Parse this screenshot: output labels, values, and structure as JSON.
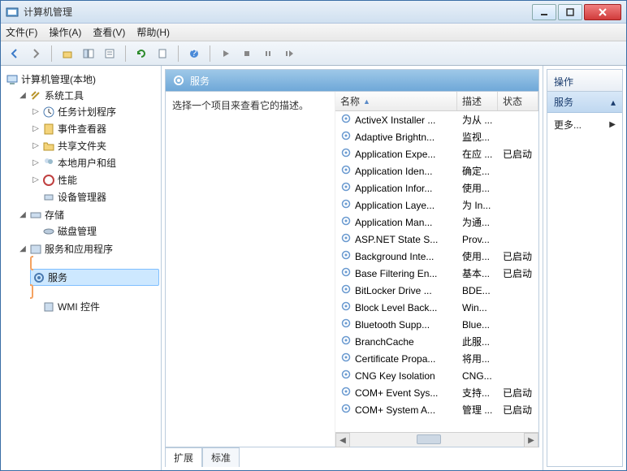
{
  "window": {
    "title": "计算机管理"
  },
  "menu": {
    "file": "文件(F)",
    "action": "操作(A)",
    "view": "查看(V)",
    "help": "帮助(H)"
  },
  "tree": {
    "root": "计算机管理(本地)",
    "systools": "系统工具",
    "task_scheduler": "任务计划程序",
    "event_viewer": "事件查看器",
    "shared_folders": "共享文件夹",
    "local_users": "本地用户和组",
    "performance": "性能",
    "device_manager": "设备管理器",
    "storage": "存储",
    "disk_mgmt": "磁盘管理",
    "services_apps": "服务和应用程序",
    "services": "服务",
    "wmi": "WMI 控件"
  },
  "mid": {
    "header": "服务",
    "prompt": "选择一个项目来查看它的描述。",
    "col_name": "名称",
    "col_desc": "描述",
    "col_status": "状态",
    "tab_ext": "扩展",
    "tab_std": "标准"
  },
  "services": [
    {
      "name": "ActiveX Installer ...",
      "desc": "为从 ...",
      "status": ""
    },
    {
      "name": "Adaptive Brightn...",
      "desc": "监视...",
      "status": ""
    },
    {
      "name": "Application Expe...",
      "desc": "在应 ...",
      "status": "已启动"
    },
    {
      "name": "Application Iden...",
      "desc": "确定...",
      "status": ""
    },
    {
      "name": "Application Infor...",
      "desc": "使用...",
      "status": ""
    },
    {
      "name": "Application Laye...",
      "desc": "为 In...",
      "status": ""
    },
    {
      "name": "Application Man...",
      "desc": "为通...",
      "status": ""
    },
    {
      "name": "ASP.NET State S...",
      "desc": "Prov...",
      "status": ""
    },
    {
      "name": "Background Inte...",
      "desc": "使用...",
      "status": "已启动"
    },
    {
      "name": "Base Filtering En...",
      "desc": "基本...",
      "status": "已启动"
    },
    {
      "name": "BitLocker Drive ...",
      "desc": "BDE...",
      "status": ""
    },
    {
      "name": "Block Level Back...",
      "desc": "Win...",
      "status": ""
    },
    {
      "name": "Bluetooth Supp...",
      "desc": "Blue...",
      "status": ""
    },
    {
      "name": "BranchCache",
      "desc": "此服...",
      "status": ""
    },
    {
      "name": "Certificate Propa...",
      "desc": "将用...",
      "status": ""
    },
    {
      "name": "CNG Key Isolation",
      "desc": "CNG...",
      "status": ""
    },
    {
      "name": "COM+ Event Sys...",
      "desc": "支持...",
      "status": "已启动"
    },
    {
      "name": "COM+ System A...",
      "desc": "管理 ...",
      "status": "已启动"
    }
  ],
  "actions": {
    "header": "操作",
    "section": "服务",
    "more": "更多..."
  }
}
